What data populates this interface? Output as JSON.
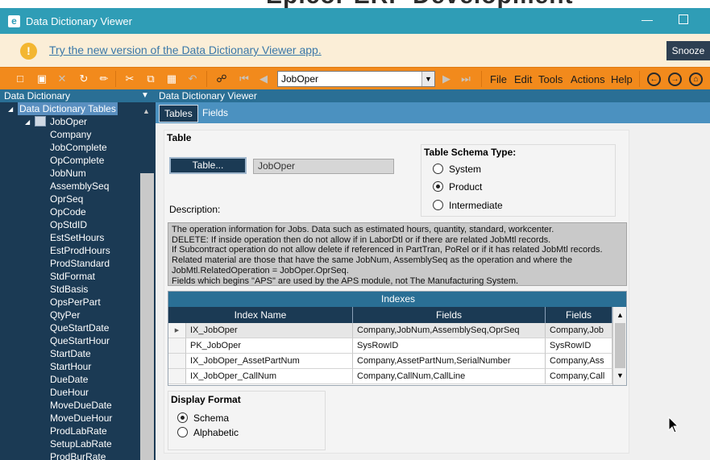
{
  "window": {
    "title": "Data Dictionary Viewer",
    "app_icon": "e",
    "minimize_glyph": "—"
  },
  "background_text": "Epicor ERP Development",
  "banner": {
    "icon": "warning-icon",
    "link_text": "Try the new version of the Data Dictionary Viewer app.",
    "snooze_label": "Snooze"
  },
  "toolbar": {
    "icons": [
      "new-icon",
      "save-icon",
      "delete-icon",
      "refresh-icon",
      "clear-icon",
      "cut-icon",
      "copy-icon",
      "paste-icon",
      "undo-icon",
      "search-icon",
      "first-icon",
      "prev-icon",
      "next-icon",
      "last-icon"
    ],
    "combo_value": "JobOper",
    "menus": [
      "File",
      "Edit",
      "Tools",
      "Actions",
      "Help"
    ],
    "nav_icons": [
      "back-icon",
      "forward-icon",
      "home-icon"
    ]
  },
  "left_panel": {
    "title": "Data Dictionary",
    "root": "Data Dictionary Tables",
    "table": "JobOper",
    "fields": [
      "Company",
      "JobComplete",
      "OpComplete",
      "JobNum",
      "AssemblySeq",
      "OprSeq",
      "OpCode",
      "OpStdID",
      "EstSetHours",
      "EstProdHours",
      "ProdStandard",
      "StdFormat",
      "StdBasis",
      "OpsPerPart",
      "QtyPer",
      "QueStartDate",
      "QueStartHour",
      "StartDate",
      "StartHour",
      "DueDate",
      "DueHour",
      "MoveDueDate",
      "MoveDueHour",
      "ProdLabRate",
      "SetupLabRate",
      "ProdBurRate"
    ]
  },
  "right_panel": {
    "title": "Data Dictionary Viewer",
    "tabs": [
      "Tables",
      "Fields"
    ],
    "table_label": "Table",
    "table_button": "Table...",
    "table_value": "JobOper",
    "schema_label": "Table Schema Type:",
    "schema_options": [
      "System",
      "Product",
      "Intermediate"
    ],
    "schema_selected": "Product",
    "description_label": "Description:",
    "description_lines": [
      "The operation information for Jobs.  Data such as estimated hours, quantity, standard, workcenter.",
      "DELETE: If inside operation then do not allow if in LaborDtl or if there are related JobMtl records.",
      "If Subcontract operation do not allow delete if referenced in PartTran, PoRel or if it has related JobMtl records.",
      "Related material are those that have the same JobNum, AssemblySeq as the operation and where the",
      "JobMtl.RelatedOperation = JobOper.OprSeq.",
      "Fields which begins \"APS\" are used by the APS module, not The Manufacturing System."
    ],
    "indexes": {
      "title": "Indexes",
      "columns": [
        "Index Name",
        "Fields",
        "Fields"
      ],
      "rows": [
        [
          "IX_JobOper",
          "Company,JobNum,AssemblySeq,OprSeq",
          "Company,Job"
        ],
        [
          "PK_JobOper",
          "SysRowID",
          "SysRowID"
        ],
        [
          "IX_JobOper_AssetPartNum",
          "Company,AssetPartNum,SerialNumber",
          "Company,Ass"
        ],
        [
          "IX_JobOper_CallNum",
          "Company,CallNum,CallLine",
          "Company,Call"
        ]
      ]
    },
    "display_format": {
      "label": "Display Format",
      "options": [
        "Schema",
        "Alphabetic"
      ],
      "selected": "Schema"
    }
  },
  "colors": {
    "titlebar": "#2f9db6",
    "toolbar": "#f28a1c",
    "panel_dark": "#1b3a54",
    "panel_header": "#2a6f95",
    "banner": "#fbeed7"
  }
}
